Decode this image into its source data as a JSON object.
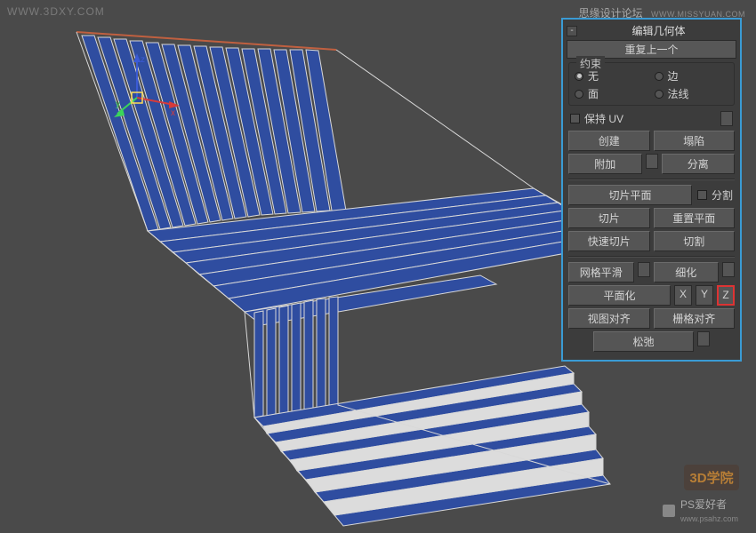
{
  "watermarks": {
    "topLeft": "WWW.3DXY.COM",
    "topRightMain": "思缘设计论坛",
    "topRightSub": "WWW.MISSYUAN.COM",
    "bottomRight": "PS爱好者",
    "bottomRightSub": "www.psahz.com",
    "logo3d": "3D学院"
  },
  "axes": {
    "x": "x",
    "y": "y",
    "z": "z"
  },
  "panel": {
    "minimize": "-",
    "title": "编辑几何体",
    "rollout": "重复上一个",
    "constraintsTitle": "约束",
    "constraints": {
      "none": "无",
      "edge": "边",
      "face": "面",
      "normal": "法线"
    },
    "preserveUV": "保持 UV",
    "create": "创建",
    "collapse": "塌陷",
    "attach": "附加",
    "detach": "分离",
    "slicePlane": "切片平面",
    "split": "分割",
    "slice": "切片",
    "resetPlane": "重置平面",
    "quickSlice": "快速切片",
    "cut": "切割",
    "msmooth": "网格平滑",
    "tessellate": "细化",
    "makePlanar": "平面化",
    "x": "X",
    "y": "Y",
    "z": "Z",
    "viewAlign": "视图对齐",
    "gridAlign": "栅格对齐",
    "relax": "松弛"
  }
}
